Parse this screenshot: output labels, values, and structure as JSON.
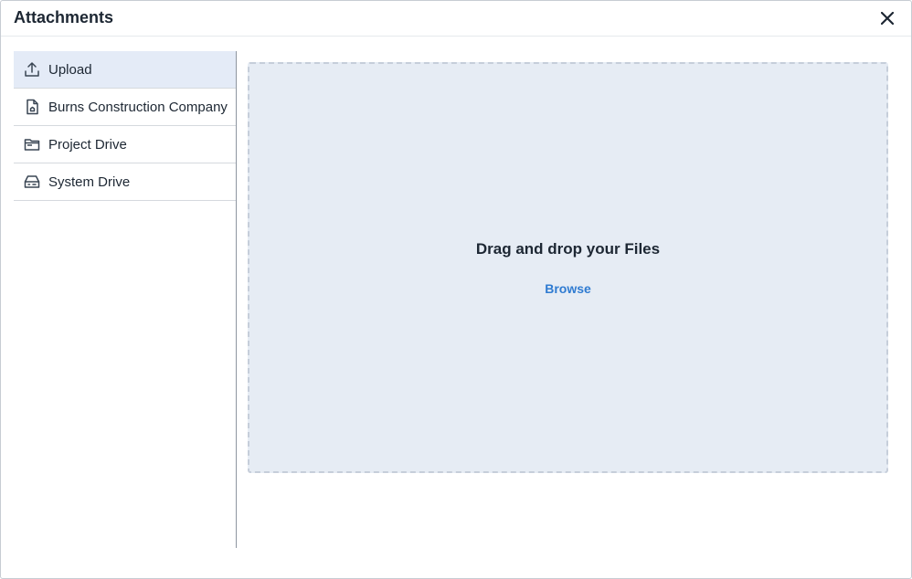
{
  "dialog": {
    "title": "Attachments",
    "close_icon": "close-icon"
  },
  "sidebar": {
    "items": [
      {
        "label": "Upload",
        "icon": "upload-icon",
        "active": true
      },
      {
        "label": "Burns Construction Company",
        "icon": "company-file-icon",
        "active": false
      },
      {
        "label": "Project Drive",
        "icon": "folder-icon",
        "active": false
      },
      {
        "label": "System Drive",
        "icon": "drive-icon",
        "active": false
      }
    ]
  },
  "dropzone": {
    "title": "Drag and drop your Files",
    "browse_label": "Browse"
  },
  "colors": {
    "active_item_bg": "#e4ebf7",
    "dropzone_bg": "#e6ecf4",
    "link": "#2f7bd1"
  }
}
